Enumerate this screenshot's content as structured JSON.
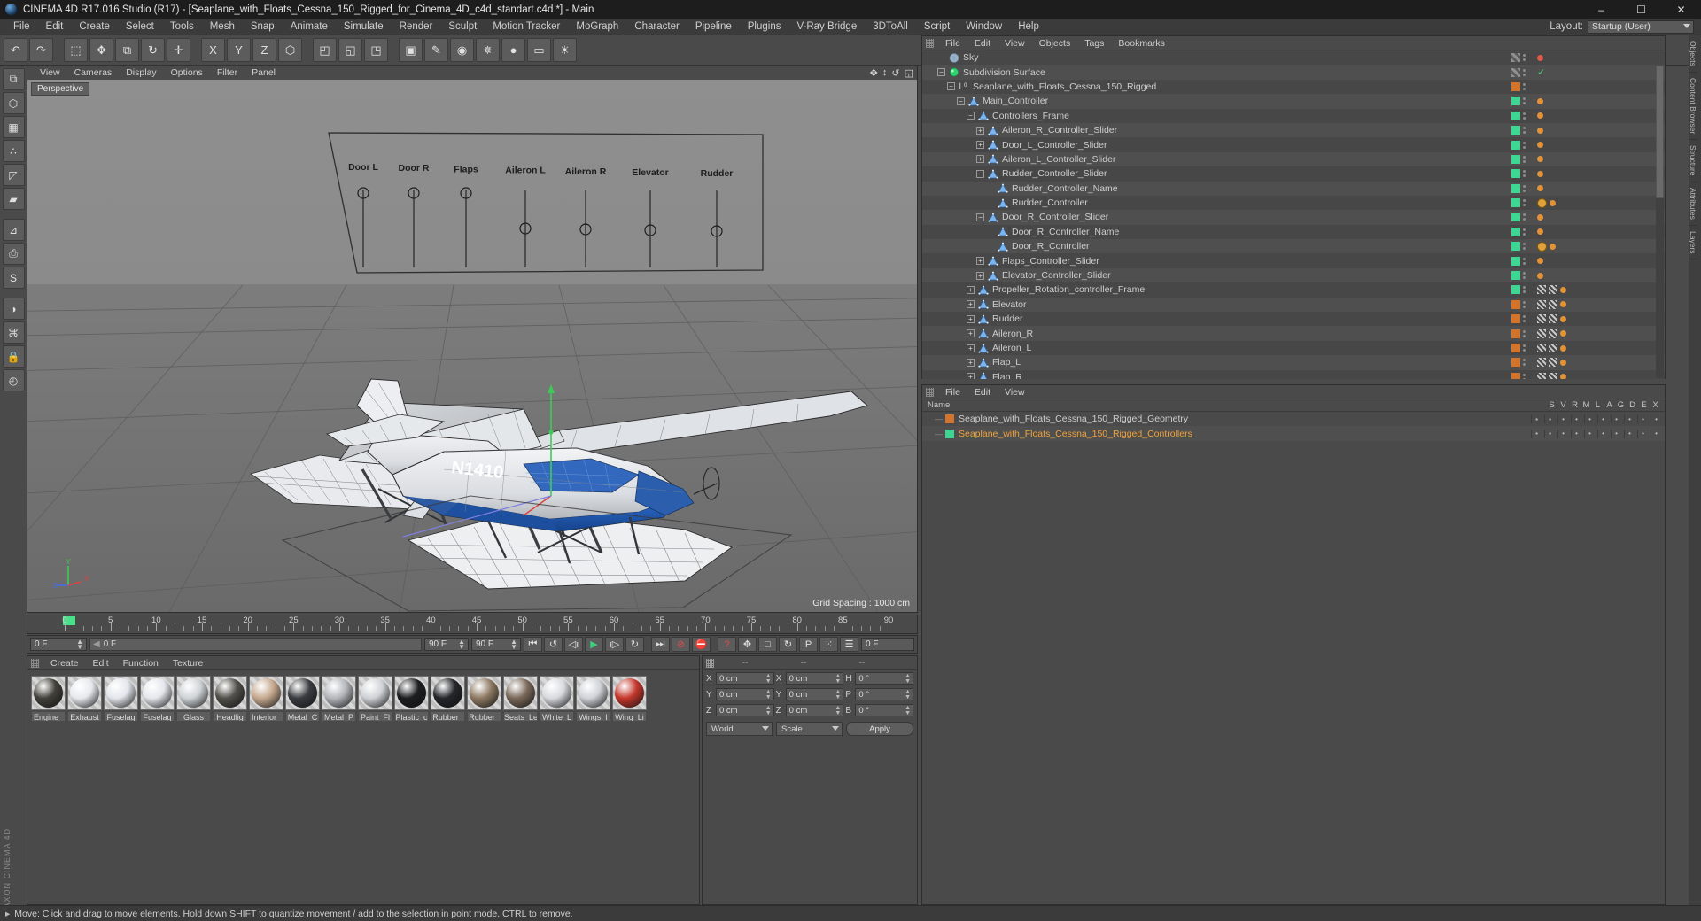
{
  "window": {
    "title": "CINEMA 4D R17.016 Studio (R17) - [Seaplane_with_Floats_Cessna_150_Rigged_for_Cinema_4D_c4d_standart.c4d *] - Main",
    "minimize": "–",
    "maximize": "☐",
    "close": "✕",
    "app_brand": "MAXON CINEMA 4D"
  },
  "menubar": {
    "items": [
      "File",
      "Edit",
      "Create",
      "Select",
      "Tools",
      "Mesh",
      "Snap",
      "Animate",
      "Simulate",
      "Render",
      "Sculpt",
      "Motion Tracker",
      "MoGraph",
      "Character",
      "Pipeline",
      "Plugins",
      "V-Ray Bridge",
      "3DToAll",
      "Script",
      "Window",
      "Help"
    ],
    "layout_label": "Layout:",
    "layout_value": "Startup (User)"
  },
  "toolbar": {
    "buttons": [
      {
        "name": "undo-button",
        "glyph": "↶"
      },
      {
        "name": "redo-button",
        "glyph": "↷"
      },
      {
        "name": "separator-1",
        "glyph": ""
      },
      {
        "name": "live-selection-tool",
        "glyph": "⬚"
      },
      {
        "name": "move-tool",
        "glyph": "✥"
      },
      {
        "name": "scale-tool",
        "glyph": "⧉"
      },
      {
        "name": "rotate-tool",
        "glyph": "↻"
      },
      {
        "name": "axis-tool",
        "glyph": "✛"
      },
      {
        "name": "separator-2",
        "glyph": ""
      },
      {
        "name": "x-axis-lock",
        "glyph": "X"
      },
      {
        "name": "y-axis-lock",
        "glyph": "Y"
      },
      {
        "name": "z-axis-lock",
        "glyph": "Z"
      },
      {
        "name": "world-object-coordinate",
        "glyph": "⬡"
      },
      {
        "name": "separator-3",
        "glyph": ""
      },
      {
        "name": "render-view-button",
        "glyph": "◰"
      },
      {
        "name": "render-region-button",
        "glyph": "◱"
      },
      {
        "name": "render-settings-button",
        "glyph": "◳"
      },
      {
        "name": "separator-4",
        "glyph": ""
      },
      {
        "name": "cube-primitive-button",
        "glyph": "▣"
      },
      {
        "name": "spline-pen-button",
        "glyph": "✎"
      },
      {
        "name": "generator-button",
        "glyph": "◉"
      },
      {
        "name": "deformer-button",
        "glyph": "✵"
      },
      {
        "name": "environment-button",
        "glyph": "●"
      },
      {
        "name": "camera-button",
        "glyph": "▭"
      },
      {
        "name": "light-button",
        "glyph": "☀"
      }
    ]
  },
  "left_tools": [
    {
      "name": "make-editable-button",
      "glyph": "⧉"
    },
    {
      "name": "model-mode-button",
      "glyph": "⬡"
    },
    {
      "name": "texture-mode-button",
      "glyph": "▦"
    },
    {
      "name": "points-mode-button",
      "glyph": "∴"
    },
    {
      "name": "edges-mode-button",
      "glyph": "◸"
    },
    {
      "name": "polygons-mode-button",
      "glyph": "▰"
    },
    {
      "name": "separator",
      "glyph": ""
    },
    {
      "name": "workplane-button",
      "glyph": "⊿"
    },
    {
      "name": "lock-workplane-button",
      "glyph": "⎙"
    },
    {
      "name": "snap-button",
      "glyph": "S"
    },
    {
      "name": "separator2",
      "glyph": ""
    },
    {
      "name": "viewport-solo-button",
      "glyph": "◑"
    },
    {
      "name": "enable-axis-button",
      "glyph": "⌘"
    },
    {
      "name": "lock-button",
      "glyph": "🔒"
    },
    {
      "name": "animate-button",
      "glyph": "◴"
    }
  ],
  "viewport": {
    "menu": [
      "View",
      "Cameras",
      "Display",
      "Options",
      "Filter",
      "Panel"
    ],
    "perspective_label": "Perspective",
    "grid_spacing": "Grid Spacing : 1000 cm",
    "axis_labels": {
      "x": "X",
      "y": "Y",
      "z": "Z"
    },
    "plane_labels": [
      "Door L",
      "Door R",
      "Flaps",
      "Aileron L",
      "Aileron R",
      "Elevator",
      "Rudder"
    ],
    "aircraft_registration": "N1410",
    "icons": [
      {
        "name": "viewport-move-icon",
        "glyph": "✥"
      },
      {
        "name": "viewport-scale-icon",
        "glyph": "↕"
      },
      {
        "name": "viewport-rotate-icon",
        "glyph": "↺"
      },
      {
        "name": "viewport-maximize-icon",
        "glyph": "◱"
      }
    ]
  },
  "timeline": {
    "labels": [
      "0",
      "5",
      "10",
      "15",
      "20",
      "25",
      "30",
      "35",
      "40",
      "45",
      "50",
      "55",
      "60",
      "65",
      "70",
      "75",
      "80",
      "85",
      "90"
    ],
    "current_frame_marker": "0"
  },
  "transport": {
    "current_frame": "0 F",
    "scrub_value": "0 F",
    "end_frame": "90 F",
    "preview_range": "90 F",
    "right_frame": "0 F",
    "buttons": [
      {
        "name": "go-to-start-button",
        "glyph": "⏮"
      },
      {
        "name": "previous-keyframe-button",
        "glyph": "↺"
      },
      {
        "name": "step-back-button",
        "glyph": "◁ı"
      },
      {
        "name": "play-button",
        "glyph": "▶"
      },
      {
        "name": "step-forward-button",
        "glyph": "ı▷"
      },
      {
        "name": "next-keyframe-button",
        "glyph": "↻"
      },
      {
        "name": "go-to-end-button",
        "glyph": "⏭"
      },
      {
        "name": "record-active-objects-button",
        "glyph": "⊘"
      },
      {
        "name": "autokeying-button",
        "glyph": "⛔"
      },
      {
        "name": "keyframe-selection-button",
        "glyph": "?"
      },
      {
        "name": "position-key-button",
        "glyph": "✥"
      },
      {
        "name": "scale-key-button",
        "glyph": "□"
      },
      {
        "name": "rotation-key-button",
        "glyph": "↻"
      },
      {
        "name": "parameter-key-button",
        "glyph": "P"
      },
      {
        "name": "pla-key-button",
        "glyph": "⁙"
      },
      {
        "name": "timeline-options-button",
        "glyph": "☰"
      }
    ]
  },
  "material_manager": {
    "menu": [
      "Create",
      "Edit",
      "Function",
      "Texture"
    ],
    "materials": [
      {
        "name": "Engine_",
        "color": "#43413b"
      },
      {
        "name": "Exhaust",
        "color": "#e7e9ee"
      },
      {
        "name": "Fuselag",
        "color": "#e3e6ec"
      },
      {
        "name": "Fuselag",
        "color": "#e5e7ed"
      },
      {
        "name": "Glass",
        "color": "#cfd3d6"
      },
      {
        "name": "Headlig",
        "color": "#52504a"
      },
      {
        "name": "Interior_",
        "color": "#c6a98f"
      },
      {
        "name": "Metal_C",
        "color": "#3a3d41"
      },
      {
        "name": "Metal_P",
        "color": "#b4b7bb"
      },
      {
        "name": "Paint_Fl",
        "color": "#cfd2d6"
      },
      {
        "name": "Plastic_c",
        "color": "#1d1e20"
      },
      {
        "name": "Rubber_",
        "color": "#24262a"
      },
      {
        "name": "Rubber_",
        "color": "#8e7a63"
      },
      {
        "name": "Seats_Le",
        "color": "#7a695a"
      },
      {
        "name": "White_L",
        "color": "#d8dade"
      },
      {
        "name": "Wings_I",
        "color": "#cfd2d7"
      },
      {
        "name": "Wing_Li",
        "color": "#c4372c"
      }
    ]
  },
  "coordinates": {
    "headers": [
      "--",
      "--",
      "--"
    ],
    "rows": [
      {
        "axis": "X",
        "position": "0 cm",
        "axis2": "X",
        "size": "0 cm",
        "axis3": "H",
        "rotation": "0 °"
      },
      {
        "axis": "Y",
        "position": "0 cm",
        "axis2": "Y",
        "size": "0 cm",
        "axis3": "P",
        "rotation": "0 °"
      },
      {
        "axis": "Z",
        "position": "0 cm",
        "axis2": "Z",
        "size": "0 cm",
        "axis3": "B",
        "rotation": "0 °"
      }
    ],
    "coordinate_system": "World",
    "transform_mode": "Scale",
    "apply_label": "Apply"
  },
  "object_manager": {
    "menu": [
      "File",
      "Edit",
      "View",
      "Objects",
      "Tags",
      "Bookmarks"
    ],
    "items": [
      {
        "label": "Sky",
        "depth": 1,
        "toggle": "none",
        "icon": "sky",
        "tag": "checker",
        "dot": "red"
      },
      {
        "label": "Subdivision Surface",
        "depth": 1,
        "toggle": "minus",
        "icon": "subdivision",
        "tag": "checker",
        "dot": "check"
      },
      {
        "label": "Seaplane_with_Floats_Cessna_150_Rigged",
        "depth": 2,
        "toggle": "minus",
        "icon": "layer0",
        "tag": "orange",
        "dot": "gray"
      },
      {
        "label": "Main_Controller",
        "depth": 3,
        "toggle": "minus",
        "icon": "null",
        "tag": "green",
        "dot": "orange"
      },
      {
        "label": "Controllers_Frame",
        "depth": 4,
        "toggle": "minus",
        "icon": "null",
        "tag": "green",
        "dot": "orange"
      },
      {
        "label": "Aileron_R_Controller_Slider",
        "depth": 5,
        "toggle": "plus",
        "icon": "null",
        "tag": "green",
        "dot": "orange"
      },
      {
        "label": "Door_L_Controller_Slider",
        "depth": 5,
        "toggle": "plus",
        "icon": "null",
        "tag": "green",
        "dot": "orange"
      },
      {
        "label": "Aileron_L_Controller_Slider",
        "depth": 5,
        "toggle": "plus",
        "icon": "null",
        "tag": "green",
        "dot": "orange"
      },
      {
        "label": "Rudder_Controller_Slider",
        "depth": 5,
        "toggle": "minus",
        "icon": "null",
        "tag": "green",
        "dot": "orange"
      },
      {
        "label": "Rudder_Controller_Name",
        "depth": 6,
        "toggle": "none",
        "icon": "null",
        "tag": "green",
        "dot": "orange"
      },
      {
        "label": "Rudder_Controller",
        "depth": 6,
        "toggle": "none",
        "icon": "null",
        "tag": "green",
        "dot": "clock"
      },
      {
        "label": "Door_R_Controller_Slider",
        "depth": 5,
        "toggle": "minus",
        "icon": "null",
        "tag": "green",
        "dot": "orange"
      },
      {
        "label": "Door_R_Controller_Name",
        "depth": 6,
        "toggle": "none",
        "icon": "null",
        "tag": "green",
        "dot": "orange"
      },
      {
        "label": "Door_R_Controller",
        "depth": 6,
        "toggle": "none",
        "icon": "null",
        "tag": "green",
        "dot": "clock"
      },
      {
        "label": "Flaps_Controller_Slider",
        "depth": 5,
        "toggle": "plus",
        "icon": "null",
        "tag": "green",
        "dot": "orange"
      },
      {
        "label": "Elevator_Controller_Slider",
        "depth": 5,
        "toggle": "plus",
        "icon": "null",
        "tag": "green",
        "dot": "orange"
      },
      {
        "label": "Propeller_Rotation_controller_Frame",
        "depth": 4,
        "toggle": "plus",
        "icon": "null",
        "tag": "green",
        "dot": "tex"
      },
      {
        "label": "Elevator",
        "depth": 4,
        "toggle": "plus",
        "icon": "null",
        "tag": "orange",
        "dot": "tex"
      },
      {
        "label": "Rudder",
        "depth": 4,
        "toggle": "plus",
        "icon": "null",
        "tag": "orange",
        "dot": "tex"
      },
      {
        "label": "Aileron_R",
        "depth": 4,
        "toggle": "plus",
        "icon": "null",
        "tag": "orange",
        "dot": "tex"
      },
      {
        "label": "Aileron_L",
        "depth": 4,
        "toggle": "plus",
        "icon": "null",
        "tag": "orange",
        "dot": "tex"
      },
      {
        "label": "Flap_L",
        "depth": 4,
        "toggle": "plus",
        "icon": "null",
        "tag": "orange",
        "dot": "tex"
      },
      {
        "label": "Flap_R",
        "depth": 4,
        "toggle": "plus",
        "icon": "null",
        "tag": "orange",
        "dot": "tex"
      }
    ]
  },
  "object_manager_bottom": {
    "menu": [
      "File",
      "Edit",
      "View"
    ],
    "name_header": "Name",
    "columns": [
      "S",
      "V",
      "R",
      "M",
      "L",
      "A",
      "G",
      "D",
      "E",
      "X"
    ],
    "items": [
      {
        "label": "Seaplane_with_Floats_Cessna_150_Rigged_Geometry",
        "color": "#d2742c",
        "selected": false
      },
      {
        "label": "Seaplane_with_Floats_Cessna_150_Rigged_Controllers",
        "color": "#3fd694",
        "selected": true
      }
    ]
  },
  "right_tabs": [
    "Objects",
    "Content Browser",
    "Structure",
    "Attributes",
    "Layers"
  ],
  "statusbar": {
    "message": "Move: Click and drag to move elements. Hold down SHIFT to quantize movement / add to the selection in point mode, CTRL to remove."
  },
  "colors": {
    "accent_orange": "#d2742c",
    "accent_green": "#3fd694",
    "selected_text": "#f0a23a",
    "panel_bg": "#4a4a4a",
    "title_bg": "#1d1d1d"
  }
}
